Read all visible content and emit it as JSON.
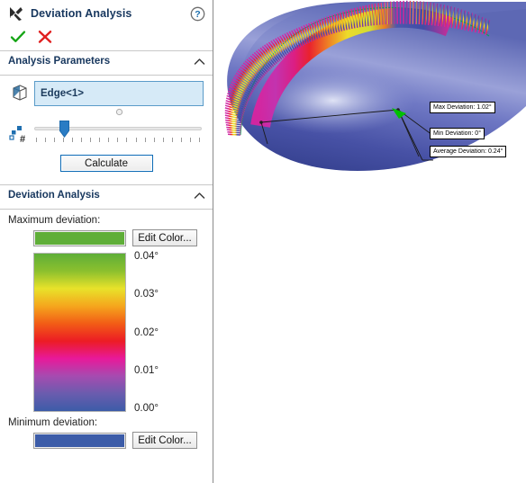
{
  "panel": {
    "title": "Deviation Analysis",
    "title_icon": "deviation-analysis-icon",
    "help_icon": "help-icon",
    "accept_icon": "checkmark-icon",
    "cancel_icon": "cross-icon",
    "sections": {
      "analysis_parameters": {
        "header": "Analysis Parameters",
        "collapse_icon": "chevron-up-icon",
        "selection": {
          "icon": "edge-selection-icon",
          "value": "Edge<1>",
          "placeholder": "Edge<1>"
        },
        "sample_slider": {
          "icon": "number-of-samples-icon",
          "value_percent": 18,
          "tick_count": 19
        },
        "calculate_label": "Calculate"
      },
      "deviation_analysis": {
        "header": "Deviation Analysis",
        "collapse_icon": "chevron-up-icon",
        "maximum_label": "Maximum deviation:",
        "maximum_color": "#5fae38",
        "maximum_edit_label": "Edit Color...",
        "minimum_label": "Minimum deviation:",
        "minimum_color": "#3c5ca8",
        "minimum_edit_label": "Edit Color...",
        "legend": {
          "ticks": [
            "0.04°",
            "0.03°",
            "0.02°",
            "0.01°",
            "0.00°"
          ],
          "stops": [
            "#5fae38",
            "#8cc02e",
            "#e8e22a",
            "#f5a61d",
            "#f25c16",
            "#ec1c24",
            "#e8199a",
            "#a64bb0",
            "#6a5cae",
            "#3c5ca8"
          ]
        }
      }
    }
  },
  "viewport": {
    "surface_color": "#4a57a8",
    "surface_highlight": "#b9bee4",
    "callouts": [
      {
        "name": "max-deviation-callout",
        "text": "Max Deviation: 1.02°"
      },
      {
        "name": "min-deviation-callout",
        "text": "Min Deviation: 0°"
      },
      {
        "name": "average-deviation-callout",
        "text": "Average Deviation: 0.24°"
      }
    ]
  }
}
